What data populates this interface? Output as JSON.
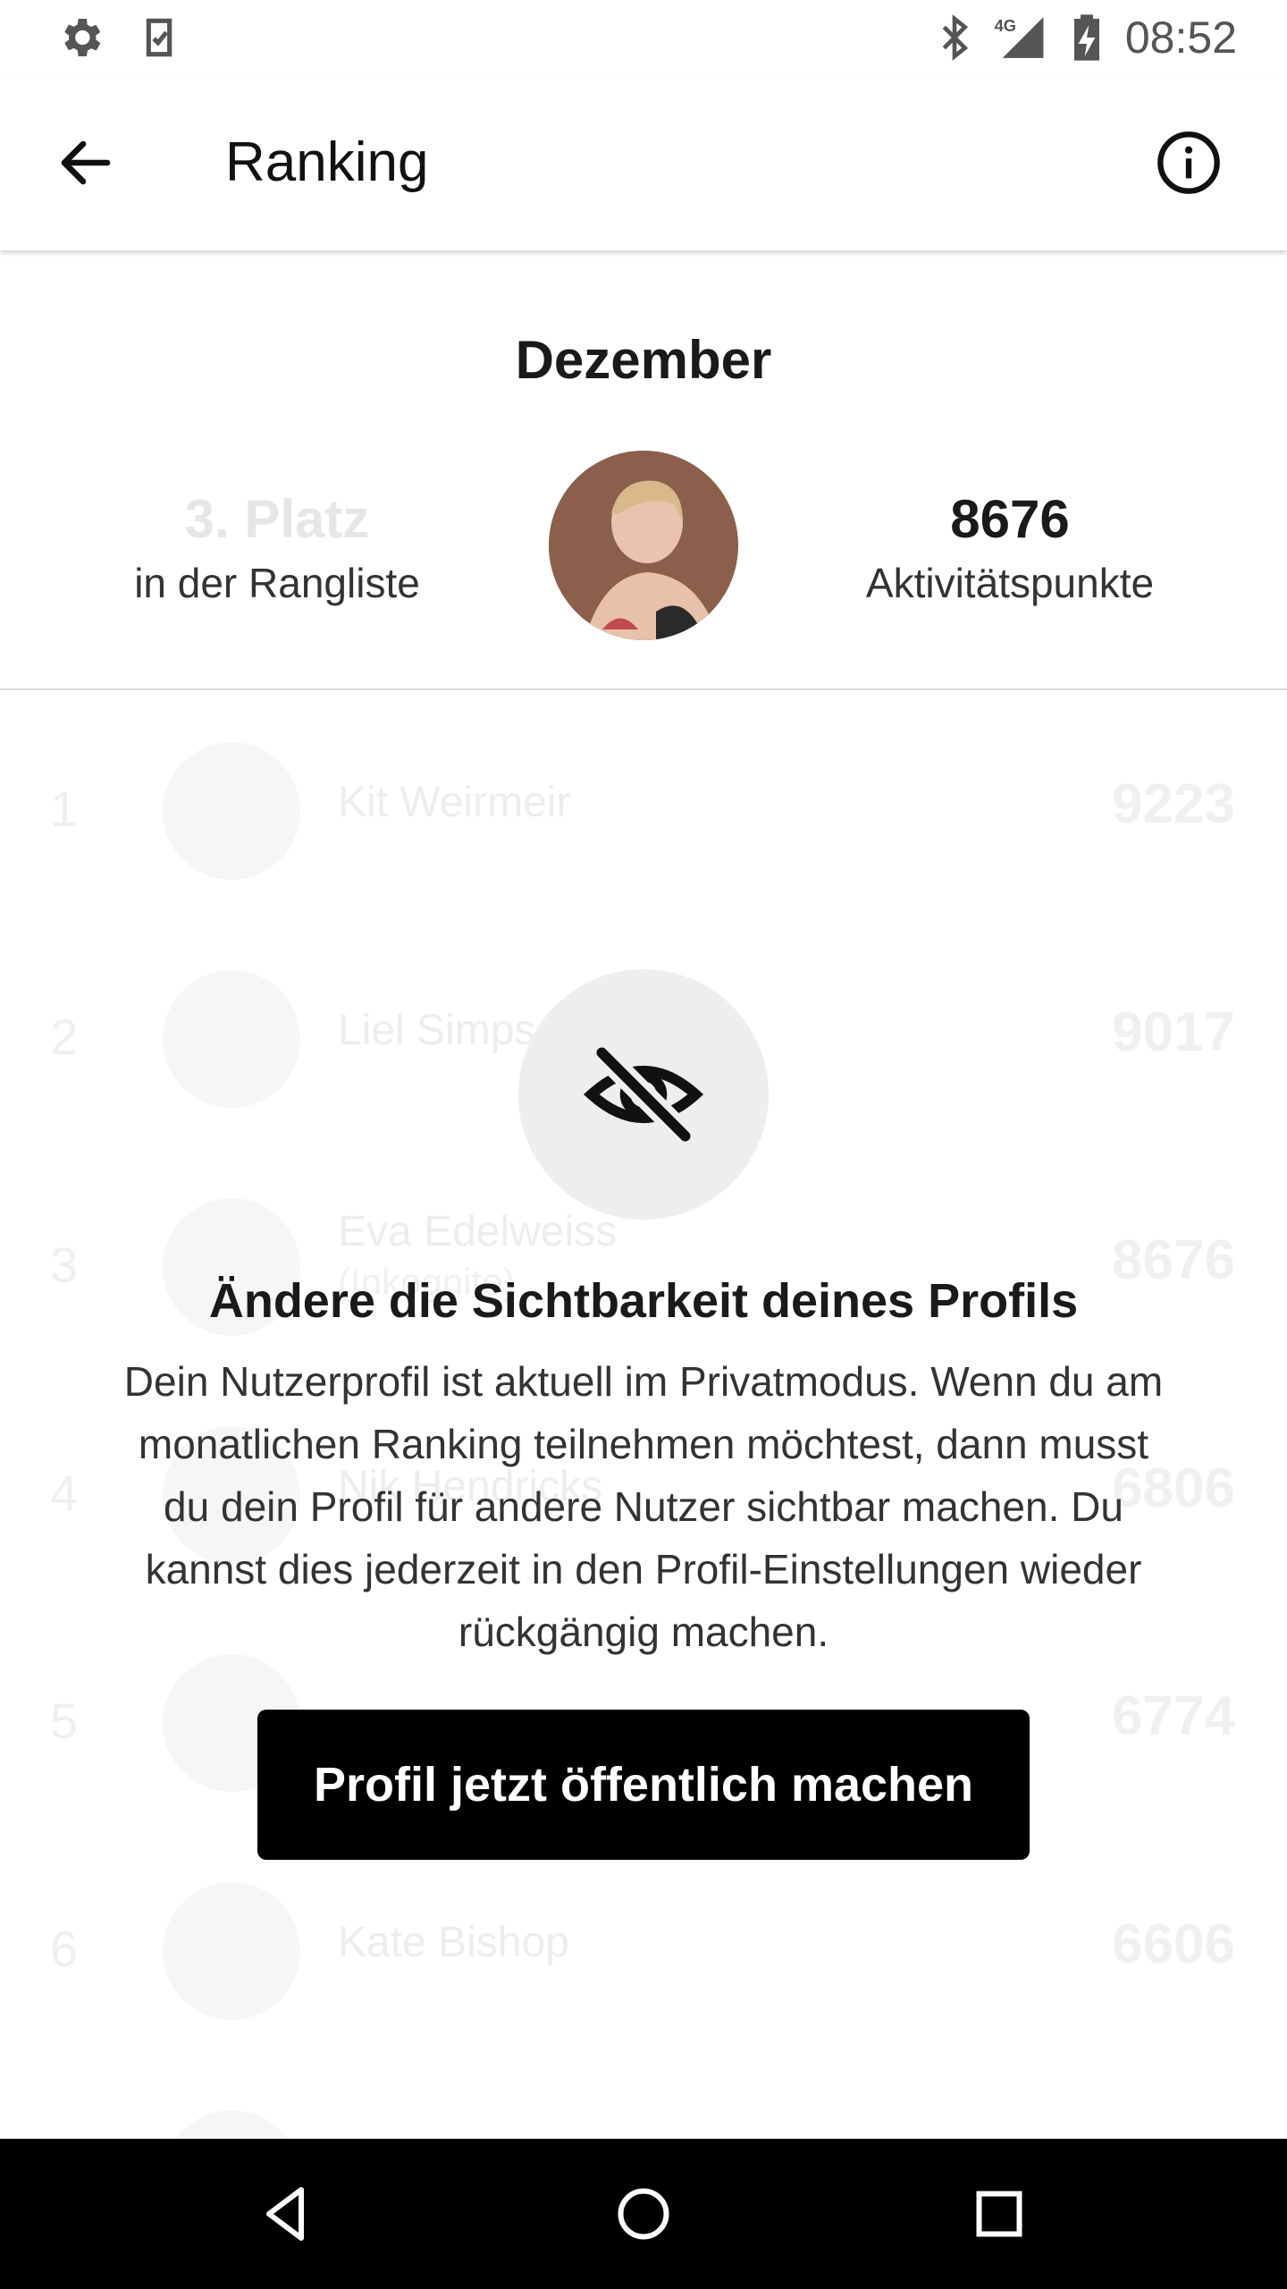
{
  "status_bar": {
    "time": "08:52",
    "network": "4G",
    "icons": [
      "settings-icon",
      "clipboard-check-icon",
      "bluetooth-icon",
      "signal-icon",
      "battery-charging-icon"
    ]
  },
  "app_bar": {
    "title": "Ranking",
    "icons": [
      "back-arrow-icon",
      "info-icon"
    ]
  },
  "summary": {
    "month": "Dezember",
    "rank_value": "3. Platz",
    "rank_label": "in der Rangliste",
    "points_value": "8676",
    "points_label": "Aktivitätspunkte"
  },
  "ranking": [
    {
      "position": "1",
      "name": "Kit Weirmeir",
      "subtitle": "",
      "score": "9223"
    },
    {
      "position": "2",
      "name": "Liel Simps",
      "subtitle": "",
      "score": "9017"
    },
    {
      "position": "3",
      "name": "Eva Edelweiss",
      "subtitle": "(Inkognito)",
      "score": "8676"
    },
    {
      "position": "4",
      "name": "Nik Hendricks",
      "subtitle": "",
      "score": "6806"
    },
    {
      "position": "5",
      "name": "",
      "subtitle": "",
      "score": "6774"
    },
    {
      "position": "6",
      "name": "Kate Bishop",
      "subtitle": "",
      "score": "6606"
    }
  ],
  "overlay": {
    "icon": "eye-off-icon",
    "title": "Ändere die Sichtbarkeit deines Profils",
    "text": "Dein Nutzerprofil ist aktuell im Privatmodus. Wenn du am monatlichen Ranking teilnehmen möchtest, dann musst du dein Profil für andere Nutzer sichtbar machen. Du kannst dies jederzeit in den Profil-Einstellungen wieder rückgängig machen.",
    "button_label": "Profil jetzt öffentlich machen"
  },
  "nav_bar": {
    "icons": [
      "nav-back-icon",
      "nav-home-icon",
      "nav-recents-icon"
    ]
  }
}
